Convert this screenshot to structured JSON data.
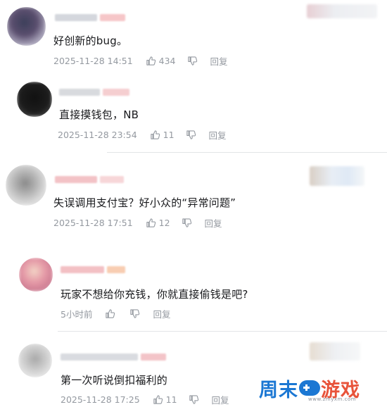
{
  "colors": {
    "text": "#18191c",
    "meta": "#9499a0",
    "divider": "#e3e5e7",
    "watermark_blue": "#1b77d3",
    "watermark_orange": "#e8533a"
  },
  "icons": {
    "like": "thumb-up-icon",
    "dislike": "thumb-down-icon"
  },
  "comments": [
    {
      "text": "好创新的bug。",
      "timestamp": "2025-11-28 14:51",
      "likes": "434",
      "reply_label": "回复"
    },
    {
      "text": "直接摸钱包，NB",
      "timestamp": "2025-11-28 23:54",
      "likes": "11",
      "reply_label": "回复"
    },
    {
      "text": "失误调用支付宝？好小众的“异常问题”",
      "timestamp": "2025-11-28 17:51",
      "likes": "12",
      "reply_label": "回复"
    },
    {
      "text": "玩家不想给你充钱，你就直接偷钱是吧?",
      "timestamp": "5小时前",
      "likes": "",
      "reply_label": "回复"
    },
    {
      "text": "第一次听说倒扣福利的",
      "timestamp": "2025-11-28 17:25",
      "likes": "11",
      "reply_label": "回复"
    }
  ],
  "watermark": {
    "part1": "周末",
    "part2": "游戏",
    "domain": "www.zmyxm.com"
  }
}
